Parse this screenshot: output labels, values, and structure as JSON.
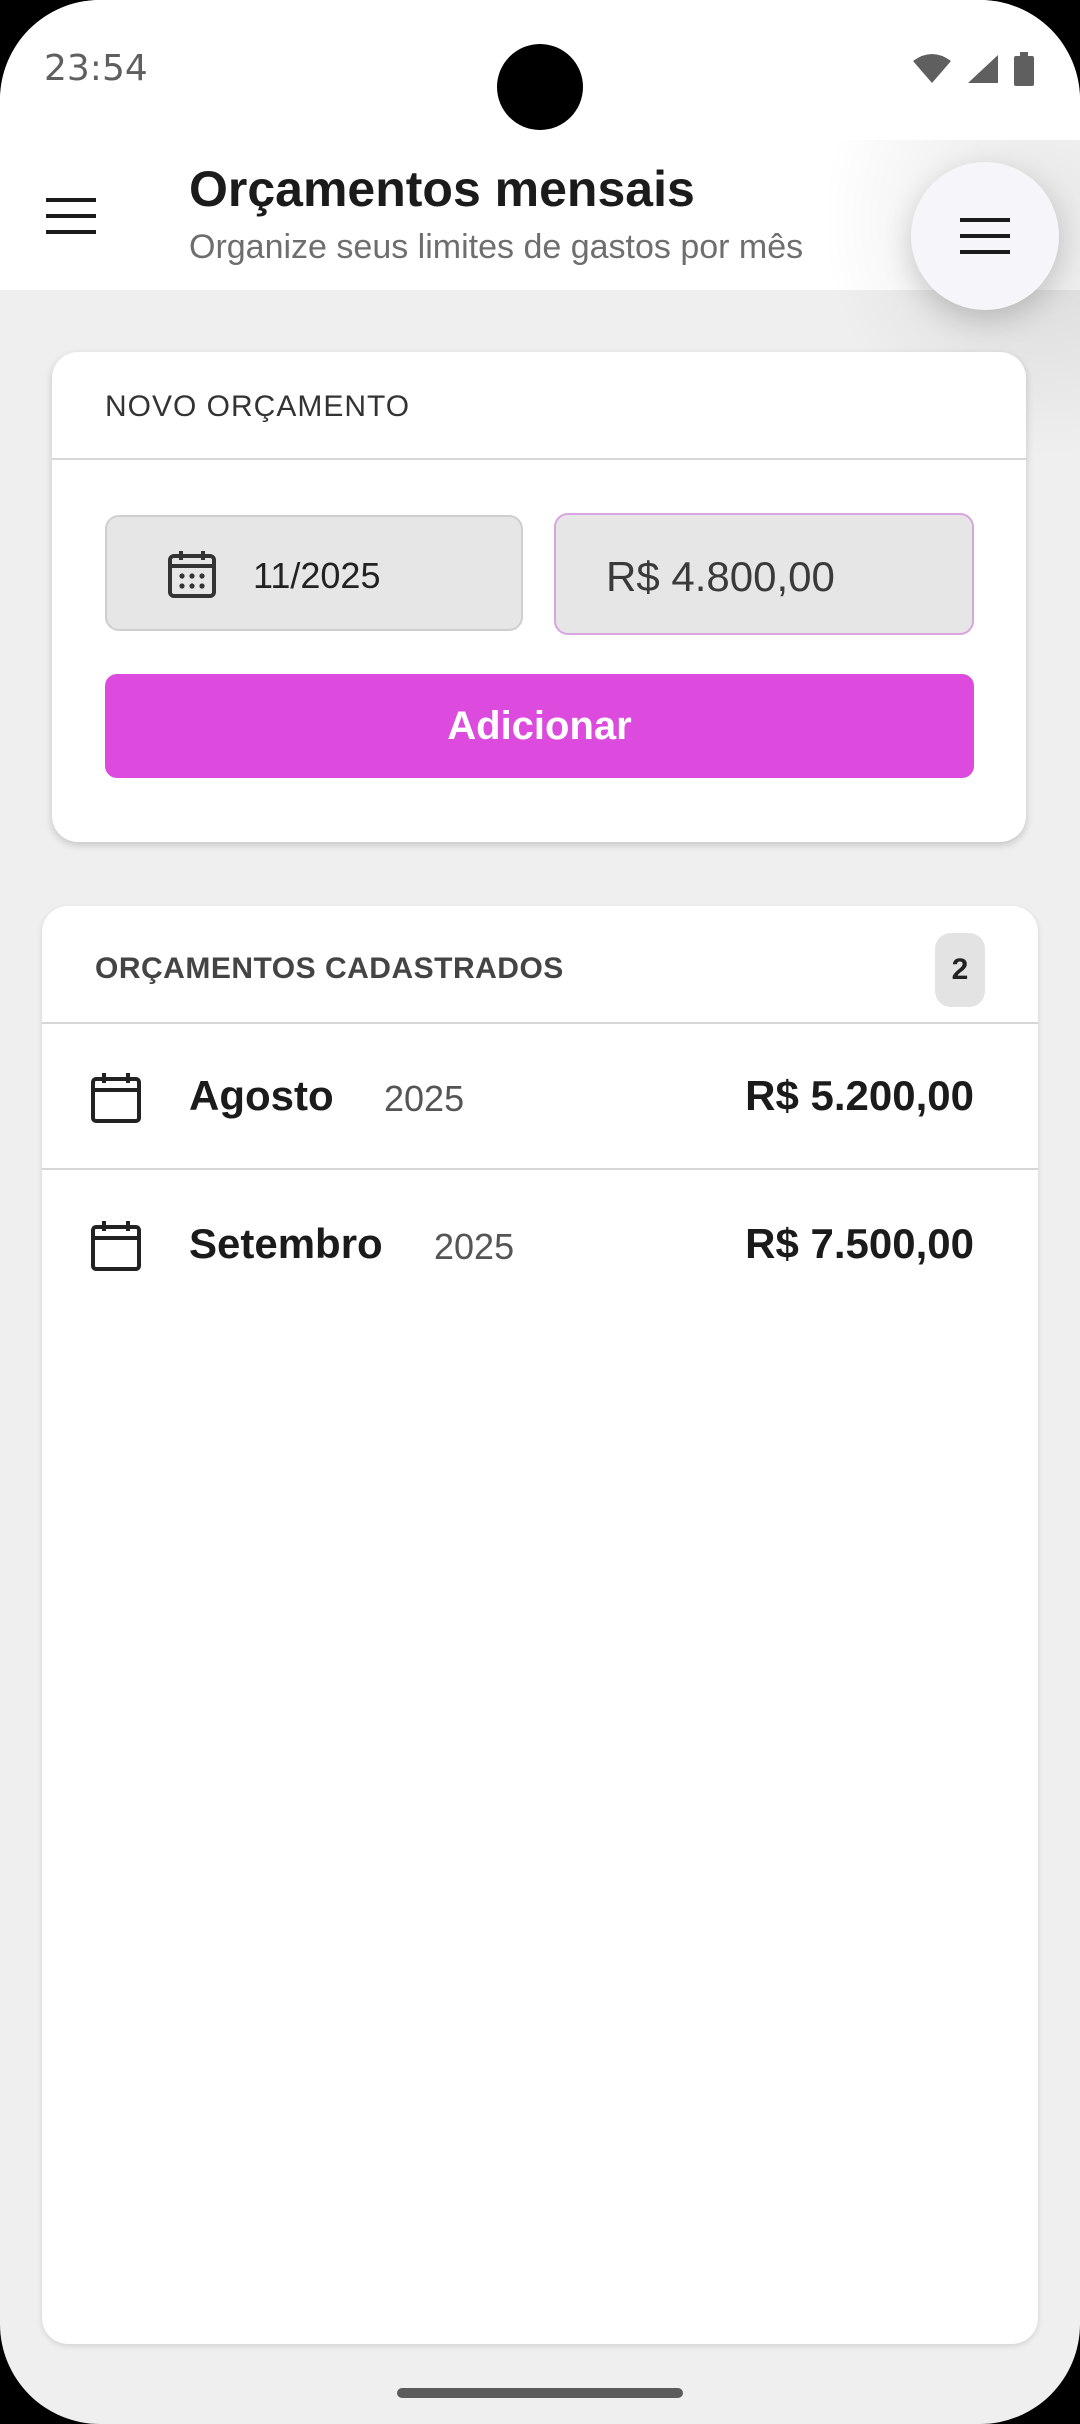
{
  "status_bar": {
    "time": "23:54"
  },
  "header": {
    "title": "Orçamentos mensais",
    "subtitle": "Organize seus limites de gastos por mês"
  },
  "new_budget": {
    "section_title": "NOVO ORÇAMENTO",
    "month_value": "11/2025",
    "amount_value": "R$ 4.800,00",
    "add_label": "Adicionar"
  },
  "budgets": {
    "section_title": "ORÇAMENTOS CADASTRADOS",
    "count": "2",
    "items": [
      {
        "month": "Agosto",
        "year": "2025",
        "amount": "R$ 5.200,00"
      },
      {
        "month": "Setembro",
        "year": "2025",
        "amount": "R$ 7.500,00"
      }
    ]
  },
  "colors": {
    "accent": "#dc4bdd"
  }
}
